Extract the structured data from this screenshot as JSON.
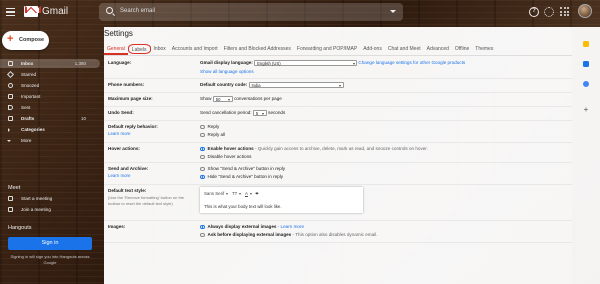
{
  "app": {
    "title": "Gmail",
    "search_placeholder": "Search email"
  },
  "compose_label": "Compose",
  "sidebar": {
    "items": [
      {
        "label": "Inbox",
        "count": "1,380",
        "active": true
      },
      {
        "label": "Starred"
      },
      {
        "label": "Snoozed"
      },
      {
        "label": "Important"
      },
      {
        "label": "Sent"
      },
      {
        "label": "Drafts",
        "count": "10"
      },
      {
        "label": "Categories"
      },
      {
        "label": "More"
      }
    ],
    "meet": {
      "label": "Meet",
      "items": [
        "Start a meeting",
        "Join a meeting"
      ]
    },
    "hangouts": {
      "label": "Hangouts",
      "signin": "Sign in",
      "note": "Signing in will sign you into Hangouts across Google"
    }
  },
  "settings": {
    "title": "Settings",
    "tabs": [
      "General",
      "Labels",
      "Inbox",
      "Accounts and Import",
      "Filters and Blocked Addresses",
      "Forwarding and POP/IMAP",
      "Add-ons",
      "Chat and Meet",
      "Advanced",
      "Offline",
      "Themes"
    ],
    "language": {
      "label": "Language:",
      "prefix": "Gmail display language:",
      "value": "English (US)",
      "link": "Change language settings for other Google products",
      "show_all": "Show all language options"
    },
    "phone": {
      "label": "Phone numbers:",
      "prefix": "Default country code:",
      "value": "India"
    },
    "page_size": {
      "label": "Maximum page size:",
      "pre": "Show",
      "value": "50",
      "post": "conversations per page"
    },
    "undo": {
      "label": "Undo Send:",
      "pre": "Send cancellation period:",
      "value": "5",
      "post": "seconds"
    },
    "reply": {
      "label": "Default reply behavior:",
      "learn": "Learn more",
      "options": [
        "Reply",
        "Reply all"
      ]
    },
    "hover": {
      "label": "Hover actions:",
      "opt1_bold": "Enable hover actions",
      "opt1_desc": "- Quickly gain access to archive, delete, mark as read, and snooze controls on hover.",
      "opt2": "Disable hover actions"
    },
    "send_archive": {
      "label": "Send and Archive:",
      "learn": "Learn more",
      "opt1": "Show \"Send & Archive\" button in reply",
      "opt2": "Hide \"Send & Archive\" button in reply"
    },
    "text_style": {
      "label": "Default text style:",
      "desc": "(Use the 'Remove formatting' button on the toolbar to reset the default text style)",
      "font": "Sans Serif",
      "sample": "This is what your body text will look like."
    },
    "images": {
      "label": "Images:",
      "opt1_bold": "Always display external images",
      "opt1_link": "Learn more",
      "opt2_bold": "Ask before displaying external images",
      "opt2_desc": "- This option also disables dynamic email."
    }
  },
  "colors": {
    "accent_red": "#d93025",
    "link_blue": "#1a73e8",
    "signin_blue": "#1a73e8"
  }
}
